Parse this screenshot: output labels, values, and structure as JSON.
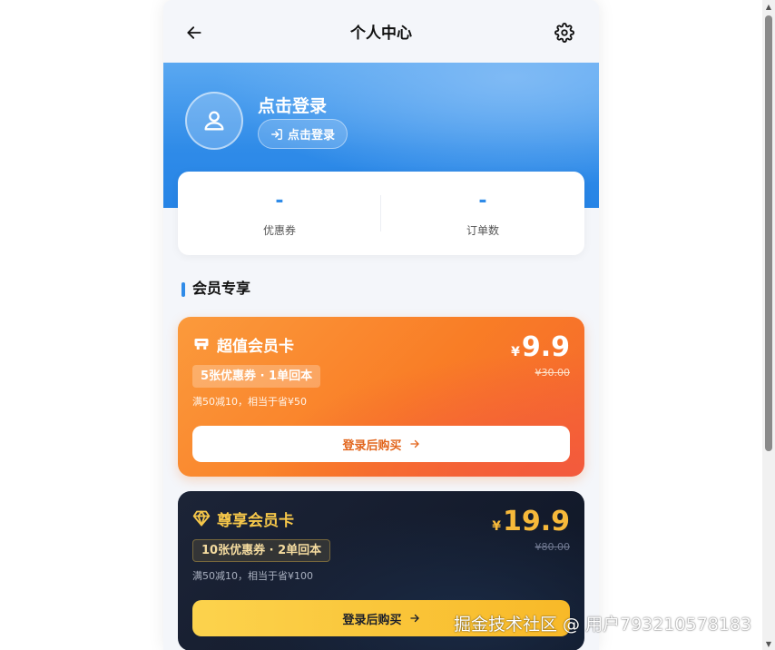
{
  "header": {
    "title": "个人中心",
    "back_icon": "arrow-left-icon",
    "settings_icon": "gear-icon"
  },
  "profile": {
    "title": "点击登录",
    "login_button": "点击登录",
    "avatar_icon": "user-icon"
  },
  "stats": [
    {
      "value": "-",
      "label": "优惠券"
    },
    {
      "value": "-",
      "label": "订单数"
    }
  ],
  "section": {
    "title": "会员专享"
  },
  "cards": [
    {
      "icon": "ticket-icon",
      "title": "超值会员卡",
      "tag": "5张优惠券 · 1单回本",
      "desc": "满50减10，相当于省¥50",
      "currency": "¥",
      "price": "9.9",
      "original_price": "¥30.00",
      "button": "登录后购买"
    },
    {
      "icon": "diamond-icon",
      "title": "尊享会员卡",
      "tag": "10张优惠券 · 2单回本",
      "desc": "满50减10，相当于省¥100",
      "currency": "¥",
      "price": "19.9",
      "original_price": "¥80.00",
      "button": "登录后购买"
    }
  ],
  "colors": {
    "accent_blue": "#2f8be8",
    "orange_card": "#f97d26",
    "dark_card": "#1c2437",
    "gold": "#f7c84a"
  },
  "watermark": "掘金技术社区 @ 用户793210578183"
}
